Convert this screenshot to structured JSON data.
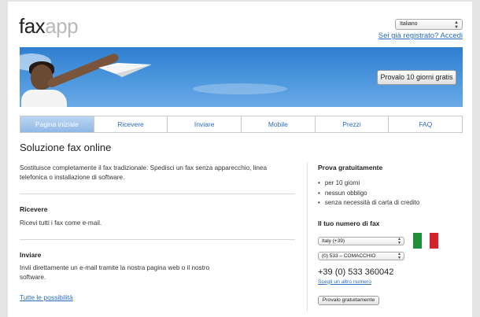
{
  "header": {
    "logo_part1": "fax",
    "logo_part2": "app",
    "language_selected": "Italiano",
    "login_link": "Sei già registrato? Accedi"
  },
  "banner": {
    "trial_button": "Provalo 10 giorni gratis"
  },
  "tabs": [
    {
      "label": "Pagina iniziale",
      "active": true
    },
    {
      "label": "Ricevere",
      "active": false
    },
    {
      "label": "Inviare",
      "active": false
    },
    {
      "label": "Mobile",
      "active": false
    },
    {
      "label": "Prezzi",
      "active": false
    },
    {
      "label": "FAQ",
      "active": false
    }
  ],
  "main": {
    "title": "Soluzione fax online",
    "intro": "Sostituisce completamente il fax tradizionale: Spedisci un fax senza apparecchio, linea telefonica o installazione di software.",
    "receive_title": "Ricevere",
    "receive_text": "Ricevi tutti i fax come e-mail.",
    "send_title": "Inviare",
    "send_text": "Invii direttamente un e-mail tramite la nostra pagina web o il nostro software.",
    "all_link": "Tutte le possibilità"
  },
  "sidebar": {
    "trial_title": "Prova gratuitamente",
    "bullets": [
      "per 10 giorni",
      "nessun obbligo",
      "senza necessità di carta di credito"
    ],
    "number_title": "Il tuo numero di fax",
    "country_selected": "Italy (+39)",
    "area_selected": "(0) 533 – COMACCHIO",
    "fax_number": "+39 (0) 533 360042",
    "choose_other_link": "Scegli un altro numero",
    "try_button": "Provalo gratuitamente"
  },
  "colors": {
    "link": "#2a6bbf",
    "banner_blue": "#3f8ad6",
    "tab_active": "#9dc0e9",
    "flag_green": "#1f8f3a",
    "flag_white": "#ffffff",
    "flag_red": "#d2232a"
  },
  "icons": [
    "dropdown-arrows-icon",
    "paper-plane-icon",
    "italy-flag-icon"
  ]
}
